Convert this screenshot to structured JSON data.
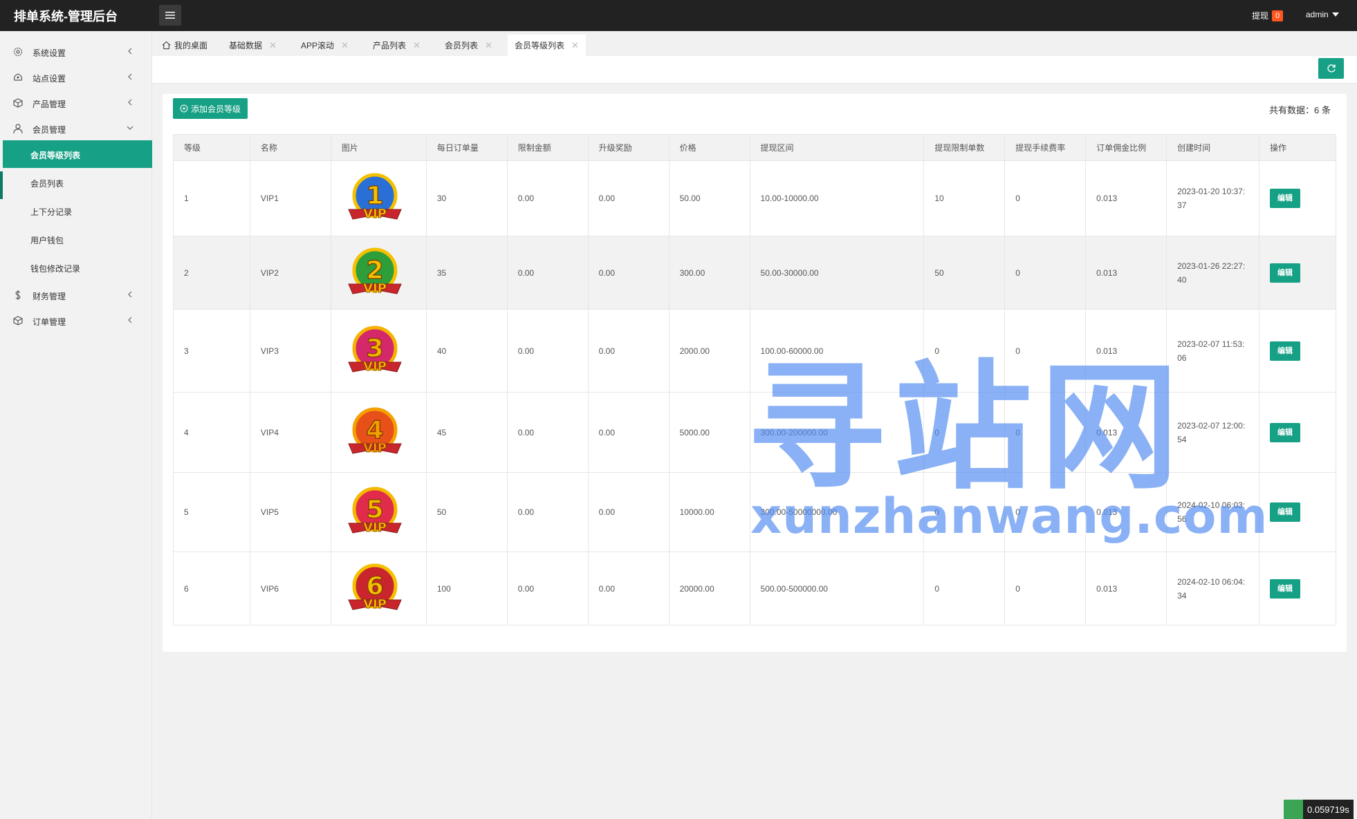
{
  "app": {
    "title": "排单系统-管理后台"
  },
  "header": {
    "withdraw_label": "提现",
    "withdraw_count": "0",
    "user": "admin"
  },
  "sidebar": {
    "groups": [
      {
        "label": "系统设置",
        "icon": "gear-icon"
      },
      {
        "label": "站点设置",
        "icon": "site-icon"
      },
      {
        "label": "产品管理",
        "icon": "box-icon"
      },
      {
        "label": "会员管理",
        "icon": "user-icon"
      },
      {
        "label": "财务管理",
        "icon": "dollar-icon"
      },
      {
        "label": "订单管理",
        "icon": "box-icon"
      }
    ],
    "member_sub": [
      "会员等级列表",
      "会员列表",
      "上下分记录",
      "用户钱包",
      "钱包修改记录"
    ]
  },
  "tabs": [
    "我的桌面",
    "基础数据",
    "APP滚动",
    "产品列表",
    "会员列表",
    "会员等级列表"
  ],
  "main": {
    "add_button": "添加会员等级",
    "count_text": "共有数据：6 条",
    "columns": [
      "等级",
      "名称",
      "图片",
      "每日订单量",
      "限制金额",
      "升级奖励",
      "价格",
      "提现区间",
      "提现限制单数",
      "提现手续费率",
      "订单佣金比例",
      "创建时间",
      "操作"
    ],
    "edit_label": "编辑",
    "rows": [
      {
        "level": "1",
        "name": "VIP1",
        "badge": "1",
        "daily": "30",
        "limit": "0.00",
        "reward": "0.00",
        "price": "50.00",
        "range": "10.00-10000.00",
        "wlimit": "10",
        "fee": "0",
        "commission": "0.013",
        "created": "2023-01-20 10:37:37"
      },
      {
        "level": "2",
        "name": "VIP2",
        "badge": "2",
        "daily": "35",
        "limit": "0.00",
        "reward": "0.00",
        "price": "300.00",
        "range": "50.00-30000.00",
        "wlimit": "50",
        "fee": "0",
        "commission": "0.013",
        "created": "2023-01-26 22:27:40"
      },
      {
        "level": "3",
        "name": "VIP3",
        "badge": "3",
        "daily": "40",
        "limit": "0.00",
        "reward": "0.00",
        "price": "2000.00",
        "range": "100.00-60000.00",
        "wlimit": "0",
        "fee": "0",
        "commission": "0.013",
        "created": "2023-02-07 11:53:06"
      },
      {
        "level": "4",
        "name": "VIP4",
        "badge": "4",
        "daily": "45",
        "limit": "0.00",
        "reward": "0.00",
        "price": "5000.00",
        "range": "300.00-200000.00",
        "wlimit": "0",
        "fee": "0",
        "commission": "0.013",
        "created": "2023-02-07 12:00:54"
      },
      {
        "level": "5",
        "name": "VIP5",
        "badge": "5",
        "daily": "50",
        "limit": "0.00",
        "reward": "0.00",
        "price": "10000.00",
        "range": "300.00-50000000.00",
        "wlimit": "0",
        "fee": "0",
        "commission": "0.013",
        "created": "2024-02-10 06:03:56"
      },
      {
        "level": "6",
        "name": "VIP6",
        "badge": "6",
        "daily": "100",
        "limit": "0.00",
        "reward": "0.00",
        "price": "20000.00",
        "range": "500.00-500000.00",
        "wlimit": "0",
        "fee": "0",
        "commission": "0.013",
        "created": "2024-02-10 06:04:34"
      }
    ]
  },
  "watermark": {
    "cn": "寻站网",
    "en": "xunzhanwang.com"
  },
  "timer": "0.059719s",
  "colors": {
    "accent": "#16a085",
    "topbar": "#222222",
    "badge": "#ff5722",
    "watermark": "#528cf0"
  }
}
